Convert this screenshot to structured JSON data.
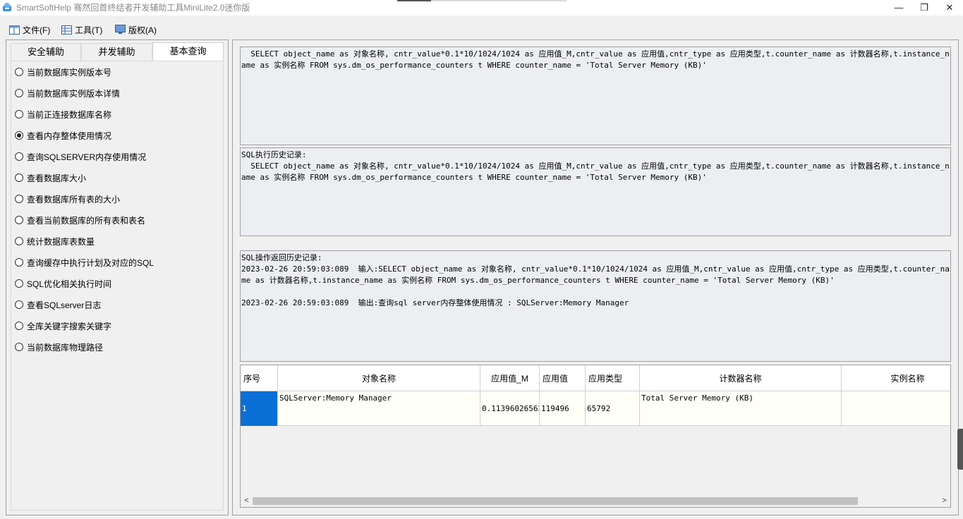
{
  "window": {
    "title": "SmartSoftHelp 骞然回首终结者开发辅助工具MiniLite2.0迷你版",
    "minimize": "—",
    "restore": "❐",
    "close": "✕"
  },
  "menu": {
    "file": "文件(F)",
    "tools": "工具(T)",
    "copyright": "版权(A)"
  },
  "tabs": {
    "security": "安全辅助",
    "concurrency": "并发辅助",
    "basic_query": "基本查询"
  },
  "queries": [
    {
      "label": "当前数据库实例版本号",
      "checked": false
    },
    {
      "label": "当前数据库实例版本详情",
      "checked": false
    },
    {
      "label": "当前正连接数据库名称",
      "checked": false
    },
    {
      "label": "查看内存整体使用情况",
      "checked": true
    },
    {
      "label": "查询SQLSERVER内存使用情况",
      "checked": false
    },
    {
      "label": "查看数据库大小",
      "checked": false
    },
    {
      "label": "查看数据库所有表的大小",
      "checked": false
    },
    {
      "label": "查看当前数据库的所有表和表名",
      "checked": false
    },
    {
      "label": "统计数据库表数量",
      "checked": false
    },
    {
      "label": "查询缓存中执行计划及对应的SQL",
      "checked": false
    },
    {
      "label": "SQL优化相关执行时间",
      "checked": false
    },
    {
      "label": "查看SQLserver日志",
      "checked": false
    },
    {
      "label": "全库关键字搜索关键字",
      "checked": false
    },
    {
      "label": "当前数据库物理路径",
      "checked": false
    }
  ],
  "sql_editor": {
    "text": "  SELECT object_name as 对象名称, cntr_value*0.1*10/1024/1024 as 应用值_M,cntr_value as 应用值,cntr_type as 应用类型,t.counter_name as 计数器名称,t.instance_name as 实例名称 FROM sys.dm_os_performance_counters t WHERE counter_name = 'Total Server Memory (KB)'"
  },
  "history": {
    "heading": "SQL执行历史记录:",
    "text": "  SELECT object_name as 对象名称, cntr_value*0.1*10/1024/1024 as 应用值_M,cntr_value as 应用值,cntr_type as 应用类型,t.counter_name as 计数器名称,t.instance_name as 实例名称 FROM sys.dm_os_performance_counters t WHERE counter_name = 'Total Server Memory (KB)'"
  },
  "results_log": {
    "heading": "SQL操作返回历史记录:",
    "input_line": "2023-02-26 20:59:03:089  输入:SELECT object_name as 对象名称, cntr_value*0.1*10/1024/1024 as 应用值_M,cntr_value as 应用值,cntr_type as 应用类型,t.counter_name as 计数器名称,t.instance_name as 实例名称 FROM sys.dm_os_performance_counters t WHERE counter_name = 'Total Server Memory (KB)'",
    "output_line": "2023-02-26 20:59:03:089  输出:查询sql server内存整体使用情况 : SQLServer:Memory Manager"
  },
  "grid": {
    "columns": [
      "序号",
      "对象名称",
      "应用值_M",
      "应用值",
      "应用类型",
      "计数器名称",
      "实例名称"
    ],
    "rows": [
      {
        "index": "1",
        "object_name": "SQLServer:Memory Manager",
        "value_m": "0.11396026562",
        "value": "119496",
        "type": "65792",
        "counter_name": "Total Server Memory (KB)",
        "instance_name": ""
      }
    ]
  },
  "scroll": {
    "left": "<",
    "right": ">"
  },
  "colors": {
    "selection": "#0a6fd6",
    "panel_bg": "#f0f0f0",
    "textbox_bg": "#eceef2"
  }
}
